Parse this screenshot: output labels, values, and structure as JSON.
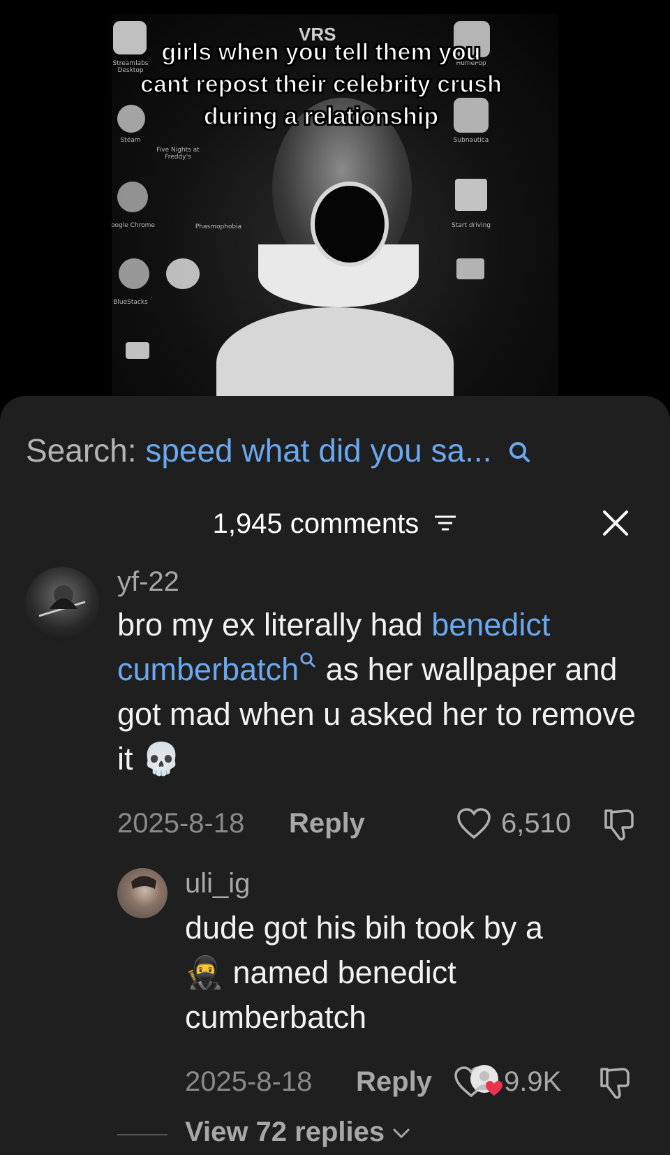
{
  "video": {
    "caption": "girls when you tell them you cant repost their celebrity crush during a relationship",
    "watermark": "VRS",
    "desktop_labels": [
      "Streamlabs Desktop",
      "Steam",
      "Google Chrome",
      "BlueStacks",
      "Five Nights at Freddy's",
      "Phasmophobia",
      "HumePop",
      "Subnautica",
      "Start driving"
    ]
  },
  "search": {
    "label": "Search:",
    "term": "speed what did you sa..."
  },
  "header": {
    "comments_count": "1,945 comments"
  },
  "comments": [
    {
      "username": "yf-22",
      "text_before": "bro my ex literally had ",
      "link_text": "benedict cumberbatch",
      "text_after": " as her wallpaper and got mad when u asked her to remove it",
      "emoji": "💀",
      "date": "2025-8-18",
      "reply_label": "Reply",
      "likes": "6,510"
    }
  ],
  "replies": [
    {
      "username": "uli_ig",
      "text_line1": "dude got his bih took by a",
      "emoji": "🥷",
      "text_line2": " named benedict",
      "text_line3": "cumberbatch",
      "date": "2025-8-18",
      "reply_label": "Reply",
      "likes": "9.9K"
    }
  ],
  "view_replies": "View 72 replies",
  "colors": {
    "accent_link": "#6aa8f0",
    "sheet_bg": "#1f1f1f",
    "heart_red": "#e8344e"
  }
}
